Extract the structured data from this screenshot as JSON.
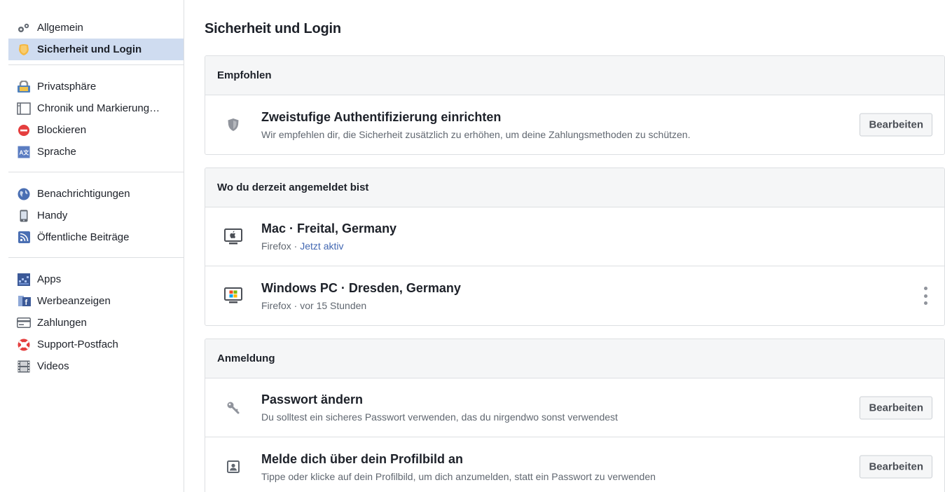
{
  "sidebar": {
    "groups": [
      [
        {
          "label": "Allgemein",
          "icon": "gears-icon"
        },
        {
          "label": "Sicherheit und Login",
          "icon": "security-badge-icon",
          "active": true
        }
      ],
      [
        {
          "label": "Privatsphäre",
          "icon": "lock-icon"
        },
        {
          "label": "Chronik und Markierung…",
          "icon": "timeline-icon"
        },
        {
          "label": "Blockieren",
          "icon": "block-icon"
        },
        {
          "label": "Sprache",
          "icon": "language-icon"
        }
      ],
      [
        {
          "label": "Benachrichtigungen",
          "icon": "globe-icon"
        },
        {
          "label": "Handy",
          "icon": "mobile-icon"
        },
        {
          "label": "Öffentliche Beiträge",
          "icon": "rss-icon"
        }
      ],
      [
        {
          "label": "Apps",
          "icon": "apps-icon"
        },
        {
          "label": "Werbeanzeigen",
          "icon": "ads-icon"
        },
        {
          "label": "Zahlungen",
          "icon": "credit-card-icon"
        },
        {
          "label": "Support-Postfach",
          "icon": "lifebuoy-icon"
        },
        {
          "label": "Videos",
          "icon": "film-icon"
        }
      ]
    ]
  },
  "main": {
    "title": "Sicherheit und Login",
    "sections": {
      "recommended": {
        "heading": "Empfohlen",
        "two_factor": {
          "title": "Zweistufige Authentifizierung einrichten",
          "subtitle": "Wir empfehlen dir, die Sicherheit zusätzlich zu erhöhen, um deine Zahlungsmethoden zu schützen.",
          "button": "Bearbeiten"
        }
      },
      "sessions": {
        "heading": "Wo du derzeit angemeldet bist",
        "items": [
          {
            "title": "Mac · Freital, Germany",
            "browser": "Firefox · ",
            "status": "Jetzt aktiv"
          },
          {
            "title": "Windows PC · Dresden, Germany",
            "browser": "Firefox · ",
            "status": "vor 15 Stunden"
          }
        ]
      },
      "login": {
        "heading": "Anmeldung",
        "change_password": {
          "title": "Passwort ändern",
          "subtitle": "Du solltest ein sicheres Passwort verwenden, das du nirgendwo sonst verwendest",
          "button": "Bearbeiten"
        },
        "profile_picture_login": {
          "title": "Melde dich über dein Profilbild an",
          "subtitle": "Tippe oder klicke auf dein Profilbild, um dich anzumelden, statt ein Passwort zu verwenden",
          "button": "Bearbeiten"
        }
      }
    }
  },
  "colors": {
    "active_nav_bg": "#cfdcf0",
    "link_blue": "#4267b2",
    "panel_header_bg": "#f5f6f7",
    "border": "#dddfe2"
  }
}
